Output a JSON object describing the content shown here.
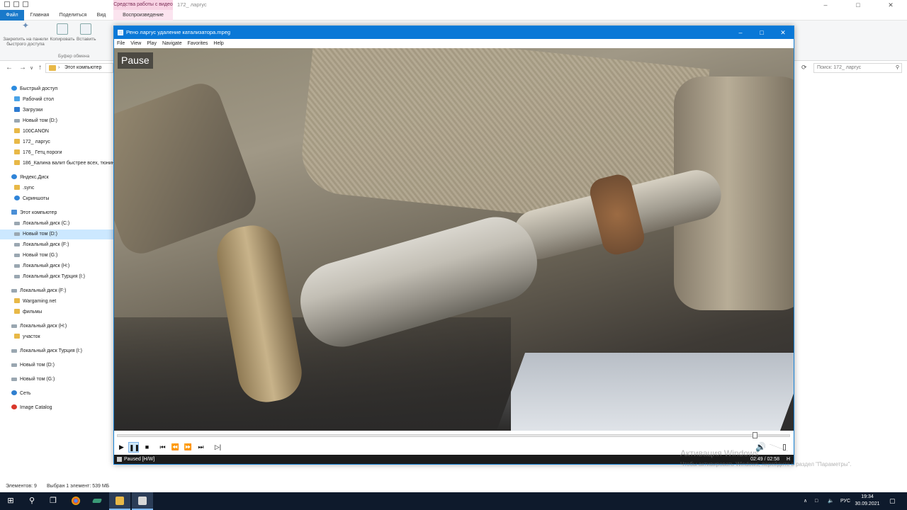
{
  "explorer": {
    "title": "172_ ларгус",
    "context_tab": "Средства работы с видео",
    "tabs": [
      "Файл",
      "Главная",
      "Поделиться",
      "Вид",
      "Воспроизведение"
    ],
    "ribbon": {
      "pin_label": "Закрепить на панели быстрого доступа",
      "copy_label": "Копировать",
      "paste_label": "Вставить",
      "clipboard_group": "Буфер обмена"
    },
    "address_path": "Этот компьютер",
    "search_placeholder": "Поиск: 172_ ларгус",
    "nav": [
      {
        "label": "Быстрый доступ",
        "icon": "star-icon"
      },
      {
        "label": "Рабочий стол",
        "icon": "desktop-icon"
      },
      {
        "label": "Загрузки",
        "icon": "download-icon"
      },
      {
        "label": "Новый том (D:)",
        "icon": "drive-icon"
      },
      {
        "label": "100CANON",
        "icon": "folder-icon"
      },
      {
        "label": "172_ ларгус",
        "icon": "folder-icon"
      },
      {
        "label": "176_ Гетц пороги",
        "icon": "folder-icon"
      },
      {
        "label": "186_Калина валит быстрее всех, тюнинг",
        "icon": "folder-icon"
      },
      {
        "label": "Яндекс.Диск",
        "icon": "yandex-disk-icon"
      },
      {
        "label": ".sync",
        "icon": "folder-icon"
      },
      {
        "label": "Скриншоты",
        "icon": "screenshot-icon"
      },
      {
        "label": "Этот компьютер",
        "icon": "computer-icon"
      },
      {
        "label": "Локальный диск (C:)",
        "icon": "drive-icon"
      },
      {
        "label": "Новый том (D:)",
        "icon": "drive-icon"
      },
      {
        "label": "Локальный диск (F:)",
        "icon": "drive-icon"
      },
      {
        "label": "Новый том (G:)",
        "icon": "drive-icon"
      },
      {
        "label": "Локальный диск (H:)",
        "icon": "drive-icon"
      },
      {
        "label": "Локальный диск Турция (I:)",
        "icon": "drive-icon"
      },
      {
        "label": "Локальный диск (F:)",
        "icon": "drive-icon"
      },
      {
        "label": "Wargaming.net",
        "icon": "folder-icon"
      },
      {
        "label": "фильмы",
        "icon": "folder-icon"
      },
      {
        "label": "Локальный диск (H:)",
        "icon": "drive-icon"
      },
      {
        "label": "участок",
        "icon": "folder-icon"
      },
      {
        "label": "Локальный диск Турция (I:)",
        "icon": "drive-icon"
      },
      {
        "label": "Новый том (D:)",
        "icon": "drive-icon"
      },
      {
        "label": "Новый том (G:)",
        "icon": "drive-icon"
      },
      {
        "label": "Сеть",
        "icon": "network-icon"
      },
      {
        "label": "Image Catalog",
        "icon": "image-catalog-icon"
      }
    ],
    "status_items": "Элементов: 9",
    "status_selected": "Выбран 1 элемент: 539 МБ"
  },
  "player": {
    "title": "Рено ларгус удаление катализатора.mpeg",
    "menu": [
      "File",
      "View",
      "Play",
      "Navigate",
      "Favorites",
      "Help"
    ],
    "osd_text": "Pause",
    "status_text": "Paused [H/W]",
    "time_text": "02:49 / 02:58",
    "status_right": "H",
    "progress_fraction": 0.949,
    "volume_fraction": 1.0
  },
  "watermark": {
    "line1": "Активация Windows",
    "line2": "Чтобы активировать Windows, перейдите в раздел \"Параметры\"."
  },
  "taskbar": {
    "language": "РУС",
    "time": "19:34",
    "date": "30.09.2021"
  }
}
